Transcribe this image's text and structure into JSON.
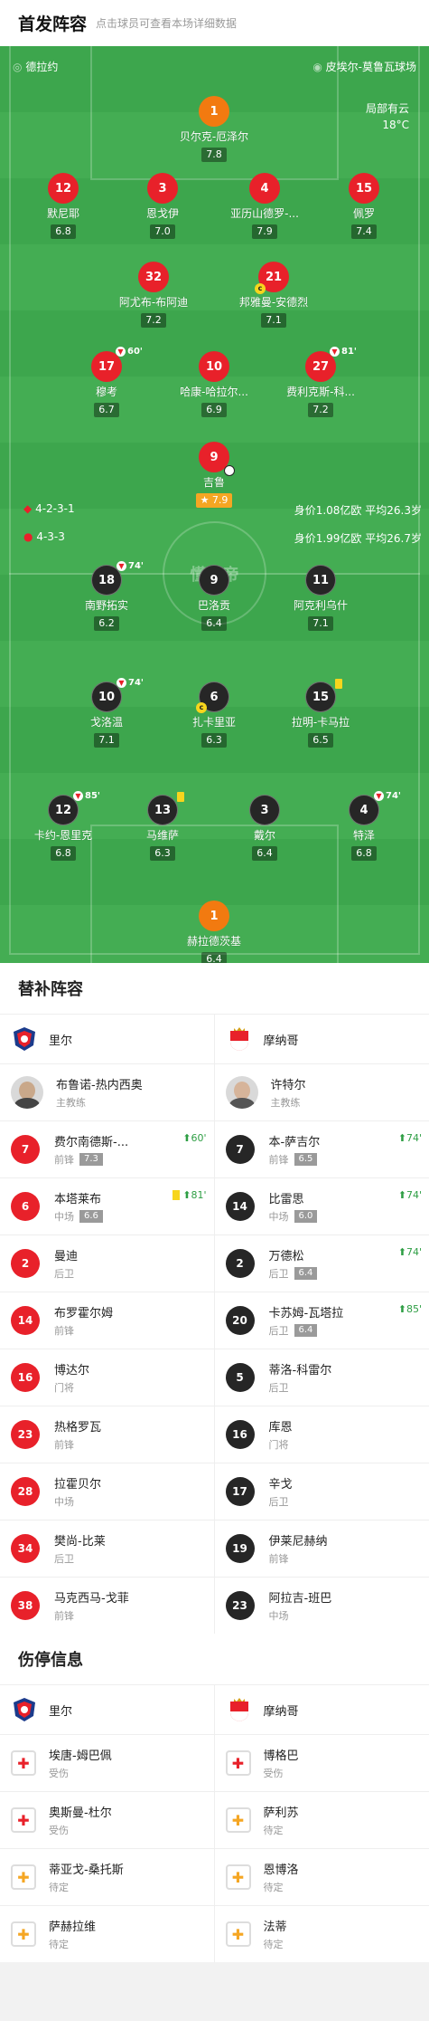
{
  "header": {
    "title": "首发阵容",
    "subtitle": "点击球员可查看本场详细数据"
  },
  "pitch": {
    "referee": "德拉约",
    "stadium": "皮埃尔-莫鲁瓦球场",
    "weather": "局部有云",
    "temp": "18°C",
    "watermark": "懂球帝",
    "home_formation": "4-2-3-1",
    "home_value": "身价1.08亿欧",
    "home_age": "平均26.3岁",
    "away_formation": "4-3-3",
    "away_value": "身价1.99亿欧",
    "away_age": "平均26.7岁"
  },
  "home_players": [
    {
      "num": "1",
      "name": "贝尔克-厄泽尔",
      "rating": "7.8"
    },
    {
      "num": "12",
      "name": "默尼耶",
      "rating": "6.8"
    },
    {
      "num": "3",
      "name": "恩戈伊",
      "rating": "7.0"
    },
    {
      "num": "4",
      "name": "亚历山德罗-...",
      "rating": "7.9"
    },
    {
      "num": "15",
      "name": "佩罗",
      "rating": "7.4"
    },
    {
      "num": "32",
      "name": "阿尤布-布阿迪",
      "rating": "7.2"
    },
    {
      "num": "21",
      "name": "邦雅曼-安德烈",
      "rating": "7.1"
    },
    {
      "num": "17",
      "name": "穆考",
      "rating": "6.7",
      "sub": "60'"
    },
    {
      "num": "10",
      "name": "哈康-哈拉尔...",
      "rating": "6.9"
    },
    {
      "num": "27",
      "name": "费利克斯-科...",
      "rating": "7.2",
      "sub": "81'"
    },
    {
      "num": "9",
      "name": "吉鲁",
      "rating": "7.9"
    }
  ],
  "away_players": [
    {
      "num": "18",
      "name": "南野拓实",
      "rating": "6.2",
      "sub": "74'"
    },
    {
      "num": "9",
      "name": "巴洛贡",
      "rating": "6.4"
    },
    {
      "num": "11",
      "name": "阿克利乌什",
      "rating": "7.1"
    },
    {
      "num": "10",
      "name": "戈洛温",
      "rating": "7.1",
      "sub": "74'"
    },
    {
      "num": "6",
      "name": "扎卡里亚",
      "rating": "6.3"
    },
    {
      "num": "15",
      "name": "拉明-卡马拉",
      "rating": "6.5"
    },
    {
      "num": "12",
      "name": "卡约-恩里克",
      "rating": "6.8",
      "sub": "85'"
    },
    {
      "num": "13",
      "name": "马维萨",
      "rating": "6.3"
    },
    {
      "num": "3",
      "name": "戴尔",
      "rating": "6.4"
    },
    {
      "num": "4",
      "name": "特泽",
      "rating": "6.8",
      "sub": "74'"
    },
    {
      "num": "1",
      "name": "赫拉德茨基",
      "rating": "6.4"
    }
  ],
  "subs": {
    "title": "替补阵容",
    "home_team": "里尔",
    "away_team": "摩纳哥",
    "home_coach": {
      "name": "布鲁诺-热内西奥",
      "role": "主教练"
    },
    "away_coach": {
      "name": "许特尔",
      "role": "主教练"
    },
    "home": [
      {
        "num": "7",
        "name": "费尔南德斯-...",
        "pos": "前锋",
        "rating": "7.3",
        "event": "60'"
      },
      {
        "num": "6",
        "name": "本塔莱布",
        "pos": "中场",
        "rating": "6.6",
        "event": "81'"
      },
      {
        "num": "2",
        "name": "曼迪",
        "pos": "后卫"
      },
      {
        "num": "14",
        "name": "布罗霍尔姆",
        "pos": "前锋"
      },
      {
        "num": "16",
        "name": "博达尔",
        "pos": "门将"
      },
      {
        "num": "23",
        "name": "热格罗瓦",
        "pos": "前锋"
      },
      {
        "num": "28",
        "name": "拉霍贝尔",
        "pos": "中场"
      },
      {
        "num": "34",
        "name": "樊尚-比莱",
        "pos": "后卫"
      },
      {
        "num": "38",
        "name": "马克西马-戈菲",
        "pos": "前锋"
      }
    ],
    "away": [
      {
        "num": "7",
        "name": "本-萨吉尔",
        "pos": "前锋",
        "rating": "6.5",
        "event": "74'"
      },
      {
        "num": "14",
        "name": "比雷思",
        "pos": "中场",
        "rating": "6.0",
        "event": "74'"
      },
      {
        "num": "2",
        "name": "万德松",
        "pos": "后卫",
        "rating": "6.4",
        "event": "74'"
      },
      {
        "num": "20",
        "name": "卡苏姆-瓦塔拉",
        "pos": "后卫",
        "rating": "6.4",
        "event": "85'"
      },
      {
        "num": "5",
        "name": "蒂洛-科雷尔",
        "pos": "后卫"
      },
      {
        "num": "16",
        "name": "库恩",
        "pos": "门将"
      },
      {
        "num": "17",
        "name": "辛戈",
        "pos": "后卫"
      },
      {
        "num": "19",
        "name": "伊莱尼赫纳",
        "pos": "前锋"
      },
      {
        "num": "23",
        "name": "阿拉吉-班巴",
        "pos": "中场"
      }
    ]
  },
  "injuries": {
    "title": "伤停信息",
    "home": [
      {
        "name": "埃唐-姆巴佩",
        "status": "受伤"
      },
      {
        "name": "奥斯曼-杜尔",
        "status": "受伤"
      },
      {
        "name": "蒂亚戈-桑托斯",
        "status": "待定"
      },
      {
        "name": "萨赫拉维",
        "status": "待定"
      }
    ],
    "away": [
      {
        "name": "博格巴",
        "status": "受伤"
      },
      {
        "name": "萨利苏",
        "status": "待定"
      },
      {
        "name": "恩博洛",
        "status": "待定"
      },
      {
        "name": "法蒂",
        "status": "待定"
      }
    ]
  },
  "colors": {
    "home": "#e8212a",
    "away": "#262626",
    "keeper": "#f27a10",
    "pitch": "#3da64d"
  }
}
